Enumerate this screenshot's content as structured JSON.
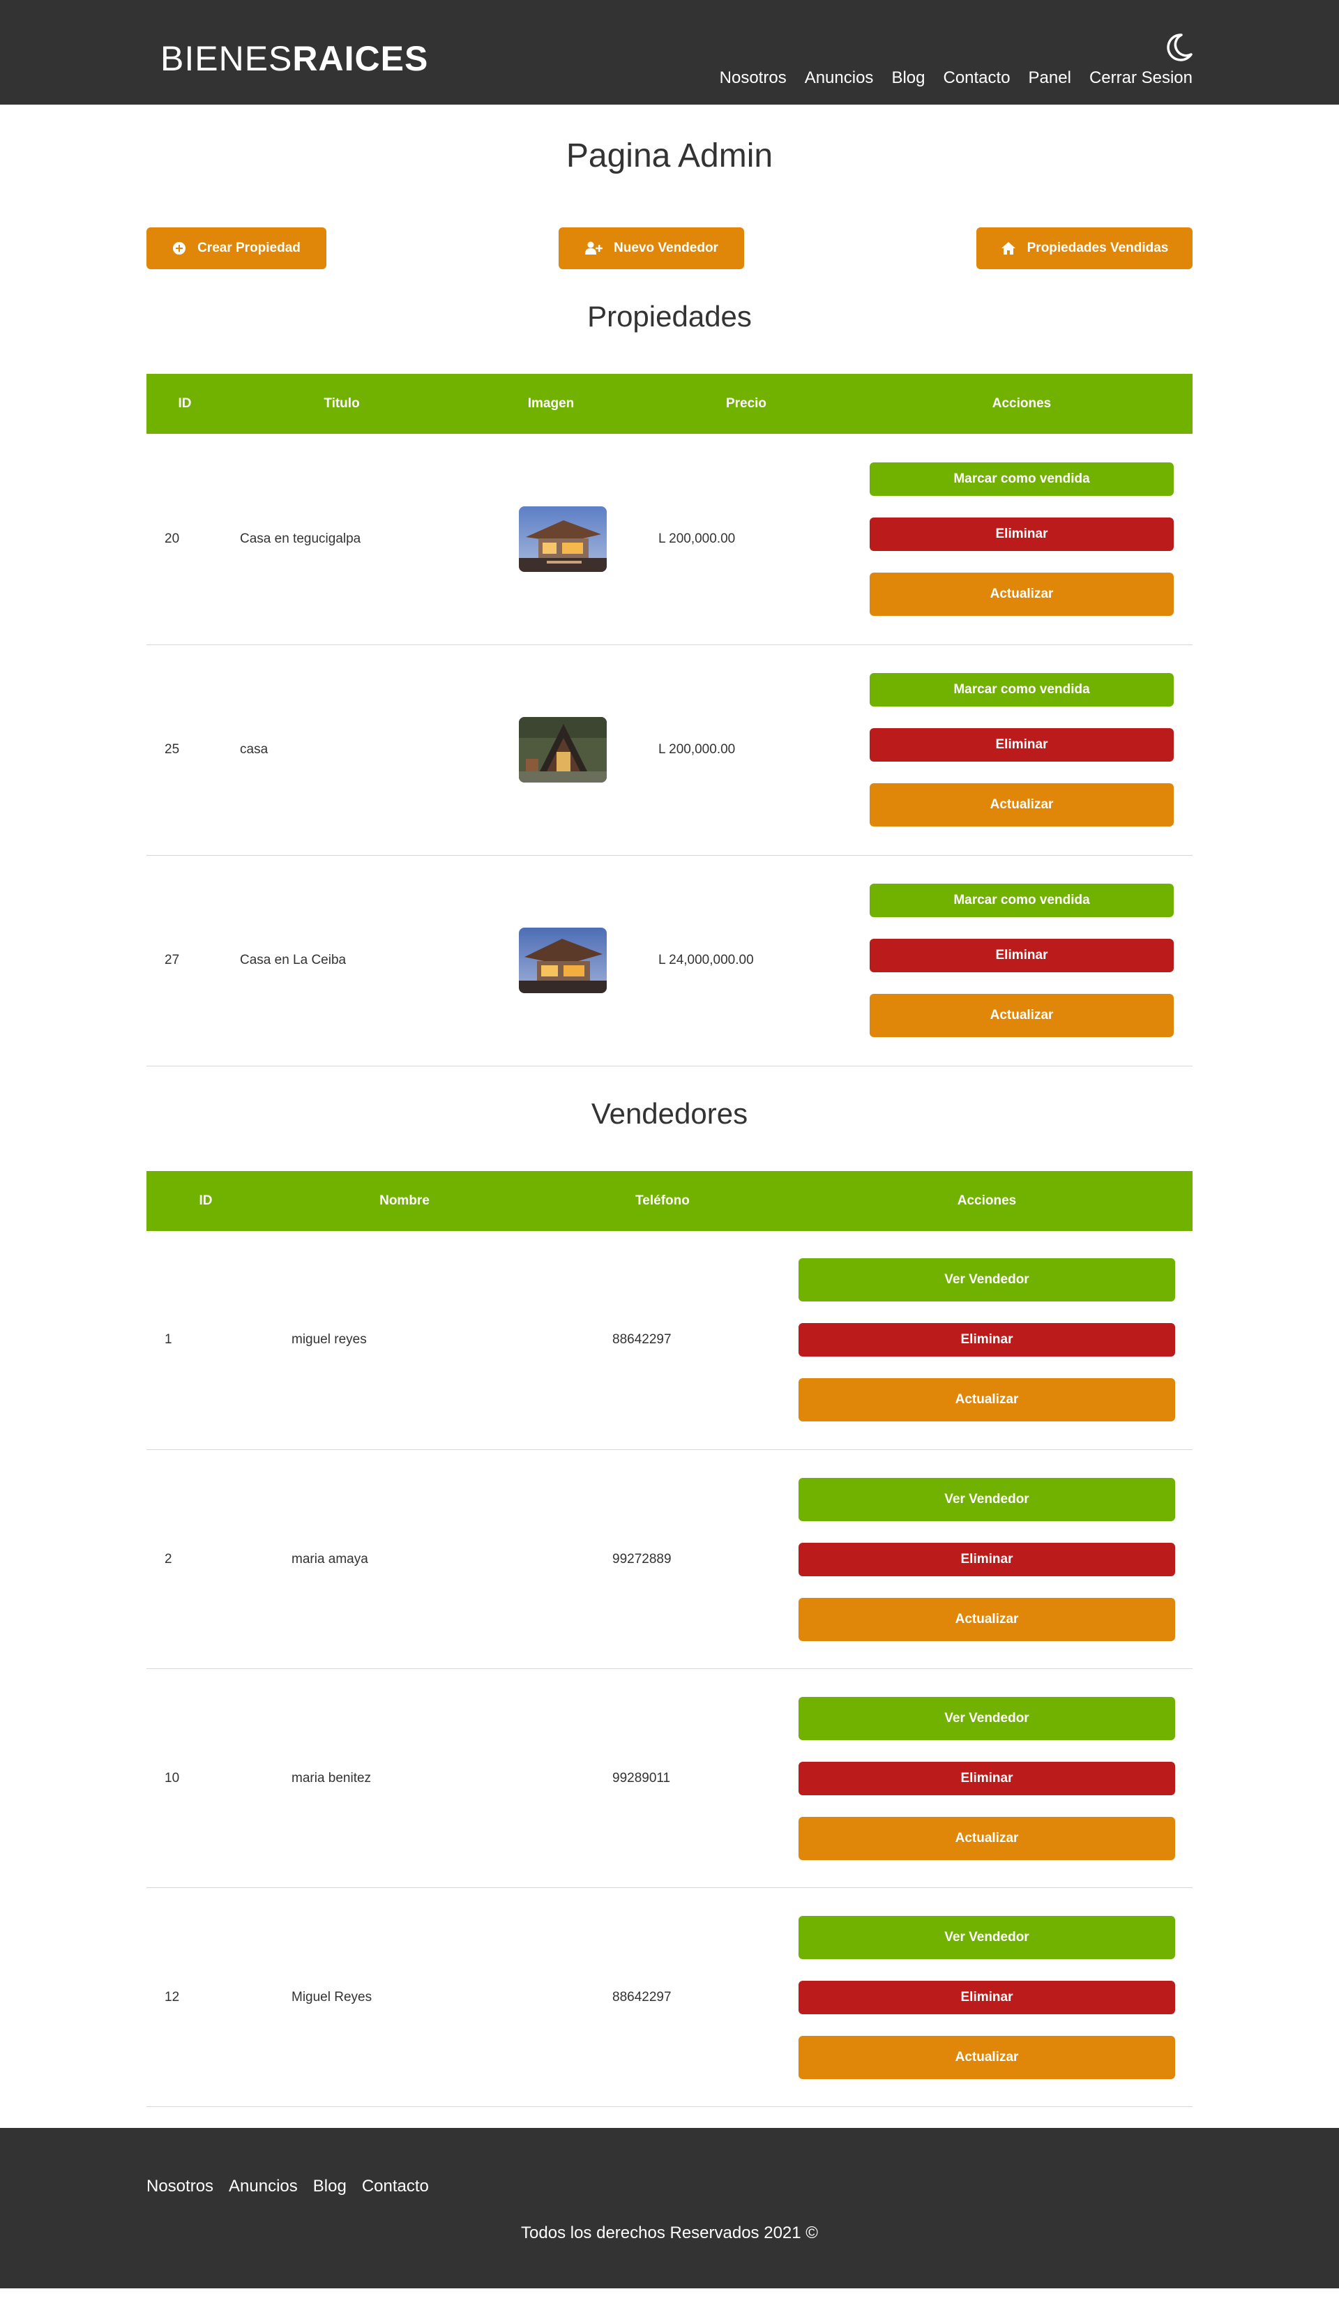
{
  "header": {
    "logo_light": "BIENES",
    "logo_bold": "RAICES",
    "nav": [
      "Nosotros",
      "Anuncios",
      "Blog",
      "Contacto",
      "Panel",
      "Cerrar Sesion"
    ]
  },
  "main": {
    "title": "Pagina Admin",
    "buttons": {
      "crear_propiedad": "Crear Propiedad",
      "nuevo_vendedor": "Nuevo Vendedor",
      "propiedades_vendidas": "Propiedades Vendidas"
    }
  },
  "propiedades": {
    "title": "Propiedades",
    "headers": [
      "ID",
      "Titulo",
      "Imagen",
      "Precio",
      "Acciones"
    ],
    "rows": [
      {
        "id": "20",
        "titulo": "Casa en tegucigalpa",
        "precio": "L 200,000.00"
      },
      {
        "id": "25",
        "titulo": "casa",
        "precio": "L 200,000.00"
      },
      {
        "id": "27",
        "titulo": "Casa en La Ceiba",
        "precio": "L 24,000,000.00"
      }
    ],
    "actions": {
      "vendida": "Marcar como vendida",
      "eliminar": "Eliminar",
      "actualizar": "Actualizar"
    }
  },
  "vendedores": {
    "title": "Vendedores",
    "headers": [
      "ID",
      "Nombre",
      "Teléfono",
      "Acciones"
    ],
    "rows": [
      {
        "id": "1",
        "nombre": "miguel reyes",
        "telefono": "88642297"
      },
      {
        "id": "2",
        "nombre": "maria amaya",
        "telefono": "99272889"
      },
      {
        "id": "10",
        "nombre": "maria benitez",
        "telefono": "99289011"
      },
      {
        "id": "12",
        "nombre": "Miguel Reyes",
        "telefono": "88642297"
      }
    ],
    "actions": {
      "ver": "Ver Vendedor",
      "eliminar": "Eliminar",
      "actualizar": "Actualizar"
    }
  },
  "footer": {
    "nav": [
      "Nosotros",
      "Anuncios",
      "Blog",
      "Contacto"
    ],
    "copyright": "Todos los derechos Reservados 2021 ©"
  },
  "colors": {
    "dark": "#333333",
    "green": "#71b100",
    "red": "#bc1b1b",
    "orange": "#e08709"
  },
  "icons": [
    "moon-icon",
    "plus-circle-icon",
    "user-plus-icon",
    "home-icon",
    "house-photo"
  ]
}
